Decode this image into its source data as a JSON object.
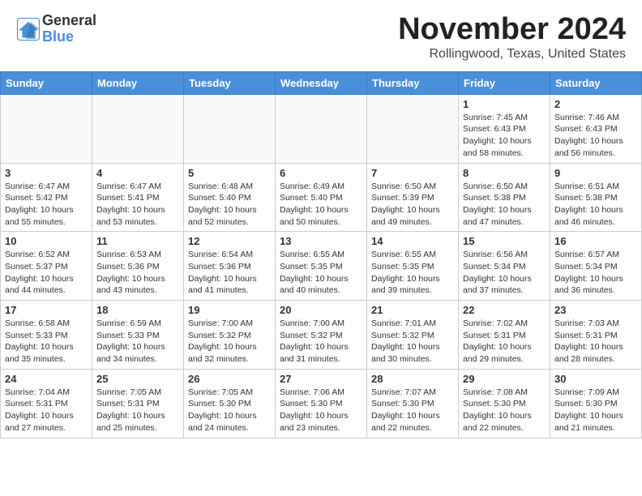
{
  "header": {
    "logo_line1": "General",
    "logo_line2": "Blue",
    "month": "November 2024",
    "location": "Rollingwood, Texas, United States"
  },
  "days_of_week": [
    "Sunday",
    "Monday",
    "Tuesday",
    "Wednesday",
    "Thursday",
    "Friday",
    "Saturday"
  ],
  "weeks": [
    [
      {
        "day": "",
        "info": ""
      },
      {
        "day": "",
        "info": ""
      },
      {
        "day": "",
        "info": ""
      },
      {
        "day": "",
        "info": ""
      },
      {
        "day": "",
        "info": ""
      },
      {
        "day": "1",
        "info": "Sunrise: 7:45 AM\nSunset: 6:43 PM\nDaylight: 10 hours and 58 minutes."
      },
      {
        "day": "2",
        "info": "Sunrise: 7:46 AM\nSunset: 6:43 PM\nDaylight: 10 hours and 56 minutes."
      }
    ],
    [
      {
        "day": "3",
        "info": "Sunrise: 6:47 AM\nSunset: 5:42 PM\nDaylight: 10 hours and 55 minutes."
      },
      {
        "day": "4",
        "info": "Sunrise: 6:47 AM\nSunset: 5:41 PM\nDaylight: 10 hours and 53 minutes."
      },
      {
        "day": "5",
        "info": "Sunrise: 6:48 AM\nSunset: 5:40 PM\nDaylight: 10 hours and 52 minutes."
      },
      {
        "day": "6",
        "info": "Sunrise: 6:49 AM\nSunset: 5:40 PM\nDaylight: 10 hours and 50 minutes."
      },
      {
        "day": "7",
        "info": "Sunrise: 6:50 AM\nSunset: 5:39 PM\nDaylight: 10 hours and 49 minutes."
      },
      {
        "day": "8",
        "info": "Sunrise: 6:50 AM\nSunset: 5:38 PM\nDaylight: 10 hours and 47 minutes."
      },
      {
        "day": "9",
        "info": "Sunrise: 6:51 AM\nSunset: 5:38 PM\nDaylight: 10 hours and 46 minutes."
      }
    ],
    [
      {
        "day": "10",
        "info": "Sunrise: 6:52 AM\nSunset: 5:37 PM\nDaylight: 10 hours and 44 minutes."
      },
      {
        "day": "11",
        "info": "Sunrise: 6:53 AM\nSunset: 5:36 PM\nDaylight: 10 hours and 43 minutes."
      },
      {
        "day": "12",
        "info": "Sunrise: 6:54 AM\nSunset: 5:36 PM\nDaylight: 10 hours and 41 minutes."
      },
      {
        "day": "13",
        "info": "Sunrise: 6:55 AM\nSunset: 5:35 PM\nDaylight: 10 hours and 40 minutes."
      },
      {
        "day": "14",
        "info": "Sunrise: 6:55 AM\nSunset: 5:35 PM\nDaylight: 10 hours and 39 minutes."
      },
      {
        "day": "15",
        "info": "Sunrise: 6:56 AM\nSunset: 5:34 PM\nDaylight: 10 hours and 37 minutes."
      },
      {
        "day": "16",
        "info": "Sunrise: 6:57 AM\nSunset: 5:34 PM\nDaylight: 10 hours and 36 minutes."
      }
    ],
    [
      {
        "day": "17",
        "info": "Sunrise: 6:58 AM\nSunset: 5:33 PM\nDaylight: 10 hours and 35 minutes."
      },
      {
        "day": "18",
        "info": "Sunrise: 6:59 AM\nSunset: 5:33 PM\nDaylight: 10 hours and 34 minutes."
      },
      {
        "day": "19",
        "info": "Sunrise: 7:00 AM\nSunset: 5:32 PM\nDaylight: 10 hours and 32 minutes."
      },
      {
        "day": "20",
        "info": "Sunrise: 7:00 AM\nSunset: 5:32 PM\nDaylight: 10 hours and 31 minutes."
      },
      {
        "day": "21",
        "info": "Sunrise: 7:01 AM\nSunset: 5:32 PM\nDaylight: 10 hours and 30 minutes."
      },
      {
        "day": "22",
        "info": "Sunrise: 7:02 AM\nSunset: 5:31 PM\nDaylight: 10 hours and 29 minutes."
      },
      {
        "day": "23",
        "info": "Sunrise: 7:03 AM\nSunset: 5:31 PM\nDaylight: 10 hours and 28 minutes."
      }
    ],
    [
      {
        "day": "24",
        "info": "Sunrise: 7:04 AM\nSunset: 5:31 PM\nDaylight: 10 hours and 27 minutes."
      },
      {
        "day": "25",
        "info": "Sunrise: 7:05 AM\nSunset: 5:31 PM\nDaylight: 10 hours and 25 minutes."
      },
      {
        "day": "26",
        "info": "Sunrise: 7:05 AM\nSunset: 5:30 PM\nDaylight: 10 hours and 24 minutes."
      },
      {
        "day": "27",
        "info": "Sunrise: 7:06 AM\nSunset: 5:30 PM\nDaylight: 10 hours and 23 minutes."
      },
      {
        "day": "28",
        "info": "Sunrise: 7:07 AM\nSunset: 5:30 PM\nDaylight: 10 hours and 22 minutes."
      },
      {
        "day": "29",
        "info": "Sunrise: 7:08 AM\nSunset: 5:30 PM\nDaylight: 10 hours and 22 minutes."
      },
      {
        "day": "30",
        "info": "Sunrise: 7:09 AM\nSunset: 5:30 PM\nDaylight: 10 hours and 21 minutes."
      }
    ]
  ]
}
